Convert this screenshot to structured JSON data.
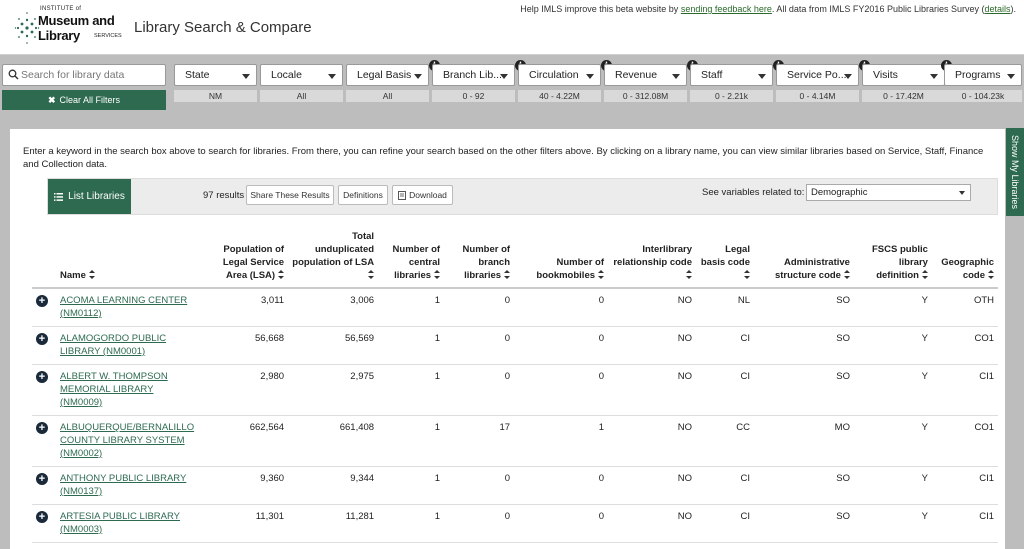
{
  "header": {
    "logo_small": "INSTITUTE of",
    "logo_main": "Museum and Library",
    "logo_services": "SERVICES",
    "title": "Library Search & Compare",
    "help_prefix": "Help IMLS improve this beta website by ",
    "help_link": "sending feedback here",
    "help_middle": ". All data from IMLS FY2016 Public Libraries Survey (",
    "help_details": "details",
    "help_suffix": ")."
  },
  "search": {
    "placeholder": "Search for library data",
    "clear_label": "Clear All Filters"
  },
  "filters": [
    {
      "label": "State",
      "range": "NM",
      "info": false
    },
    {
      "label": "Locale",
      "range": "All",
      "info": false
    },
    {
      "label": "Legal Basis",
      "range": "All",
      "info": false
    },
    {
      "label": "Branch Lib...",
      "range": "0 - 92",
      "info": true
    },
    {
      "label": "Circulation",
      "range": "40 - 4.22M",
      "info": true
    },
    {
      "label": "Revenue",
      "range": "0 - 312.08M",
      "info": true
    },
    {
      "label": "Staff",
      "range": "0 - 2.21k",
      "info": true
    },
    {
      "label": "Service Po...",
      "range": "0 - 4.14M",
      "info": true
    },
    {
      "label": "Visits",
      "range": "0 - 17.42M",
      "info": true
    },
    {
      "label": "Programs",
      "range": "0 - 104.23k",
      "info": true
    }
  ],
  "intro": "Enter a keyword in the search box above to search for libraries. From there, you can refine your search based on the other filters above. By clicking on a library name, you can view similar libraries based on Service, Staff, Finance and Collection data.",
  "toolbar": {
    "list_label": "List Libraries",
    "results": "97 results",
    "share_label": "Share These Results",
    "definitions_label": "Definitions",
    "download_label": "Download",
    "see_label": "See variables related to:",
    "see_value": "Demographic"
  },
  "show_tab": "Show My Libraries",
  "table": {
    "headers": [
      "Name",
      "Population of Legal Service Area (LSA)",
      "Total unduplicated population of LSA",
      "Number of central libraries",
      "Number of branch libraries",
      "Number of bookmobiles",
      "Interlibrary relationship code",
      "Legal basis code",
      "Administrative structure code",
      "FSCS public library definition",
      "Geographic code"
    ],
    "rows": [
      {
        "name": "ACOMA LEARNING CENTER (NM0112)",
        "pop": "3,011",
        "undup": "3,006",
        "central": "1",
        "branch": "0",
        "bookmobiles": "0",
        "interlib": "NO",
        "legal": "NL",
        "admin": "SO",
        "fscs": "Y",
        "geo": "OTH"
      },
      {
        "name": "ALAMOGORDO PUBLIC LIBRARY (NM0001)",
        "pop": "56,668",
        "undup": "56,569",
        "central": "1",
        "branch": "0",
        "bookmobiles": "0",
        "interlib": "NO",
        "legal": "CI",
        "admin": "SO",
        "fscs": "Y",
        "geo": "CO1"
      },
      {
        "name": "ALBERT W. THOMPSON MEMORIAL LIBRARY (NM0009)",
        "pop": "2,980",
        "undup": "2,975",
        "central": "1",
        "branch": "0",
        "bookmobiles": "0",
        "interlib": "NO",
        "legal": "CI",
        "admin": "SO",
        "fscs": "Y",
        "geo": "CI1"
      },
      {
        "name": "ALBUQUERQUE/BERNALILLO COUNTY LIBRARY SYSTEM (NM0002)",
        "pop": "662,564",
        "undup": "661,408",
        "central": "1",
        "branch": "17",
        "bookmobiles": "1",
        "interlib": "NO",
        "legal": "CC",
        "admin": "MO",
        "fscs": "Y",
        "geo": "CO1"
      },
      {
        "name": "ANTHONY PUBLIC LIBRARY (NM0137)",
        "pop": "9,360",
        "undup": "9,344",
        "central": "1",
        "branch": "0",
        "bookmobiles": "0",
        "interlib": "NO",
        "legal": "CI",
        "admin": "SO",
        "fscs": "Y",
        "geo": "CI1"
      },
      {
        "name": "ARTESIA PUBLIC LIBRARY (NM0003)",
        "pop": "11,301",
        "undup": "11,281",
        "central": "1",
        "branch": "0",
        "bookmobiles": "0",
        "interlib": "NO",
        "legal": "CI",
        "admin": "SO",
        "fscs": "Y",
        "geo": "CI1"
      }
    ]
  },
  "colors": {
    "brand": "#2d6a4f",
    "link": "#2d6a4f"
  }
}
